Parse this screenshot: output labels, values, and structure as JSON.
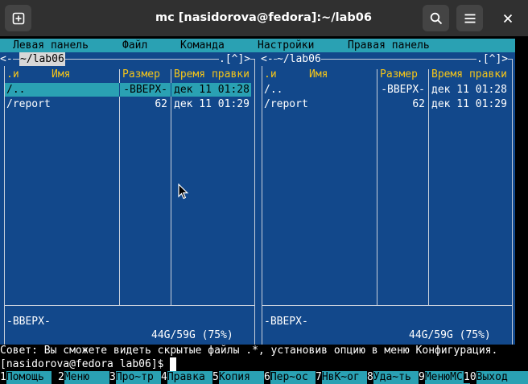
{
  "window": {
    "title": "mc [nasidorova@fedora]:~/lab06",
    "new_tab_icon": "new-tab-icon",
    "search_icon": "search-icon",
    "menu_icon": "hamburger-menu-icon",
    "close_icon": "close-icon"
  },
  "menubar": {
    "items": [
      "Левая панель",
      "Файл",
      "Команда",
      "Настройки",
      "Правая панель"
    ]
  },
  "left_panel": {
    "path": " ~/lab06 ",
    "corner_left": "<-",
    "corner_right": ".[^]>",
    "columns": {
      "sort": ".и",
      "name": "Имя",
      "size": "Размер",
      "mtime": "Время правки"
    },
    "rows": [
      {
        "name": "/..",
        "size": "-ВВЕРХ-",
        "mtime": "дек 11 01:28",
        "selected": true
      },
      {
        "name": "/report",
        "size": "62",
        "mtime": "дек 11 01:29",
        "selected": false
      }
    ],
    "mini_status": "-ВВЕРХ-",
    "disk_usage": "44G/59G (75%)"
  },
  "right_panel": {
    "path": " ~/lab06 ",
    "corner_left": "<-",
    "corner_right": ".[^]>",
    "columns": {
      "sort": ".и",
      "name": "Имя",
      "size": "Размер",
      "mtime": "Время правки"
    },
    "rows": [
      {
        "name": "/..",
        "size": "-ВВЕРХ-",
        "mtime": "дек 11 01:28",
        "selected": false
      },
      {
        "name": "/report",
        "size": "62",
        "mtime": "дек 11 01:29",
        "selected": false
      }
    ],
    "mini_status": "-ВВЕРХ-",
    "disk_usage": "44G/59G (75%)"
  },
  "hint": "Совет: Вы сможете видеть скрытые файлы .*, установив опцию в меню Конфигурация.",
  "prompt": "[nasidorova@fedora lab06]$ ",
  "fkeys": [
    {
      "num": "1",
      "label": "Помощь"
    },
    {
      "num": "2",
      "label": "Меню"
    },
    {
      "num": "3",
      "label": "Про~тр"
    },
    {
      "num": "4",
      "label": "Правка"
    },
    {
      "num": "5",
      "label": "Копия"
    },
    {
      "num": "6",
      "label": "Пер~ос"
    },
    {
      "num": "7",
      "label": "НвК~ог"
    },
    {
      "num": "8",
      "label": "Уда~ть"
    },
    {
      "num": "9",
      "label": "МенюМС"
    },
    {
      "num": "10",
      "label": "Выход"
    }
  ],
  "colors": {
    "panel_bg": "#12488b",
    "accent_cyan": "#2aa1b3",
    "header_yellow": "#f5c518",
    "titlebar": "#303030"
  }
}
